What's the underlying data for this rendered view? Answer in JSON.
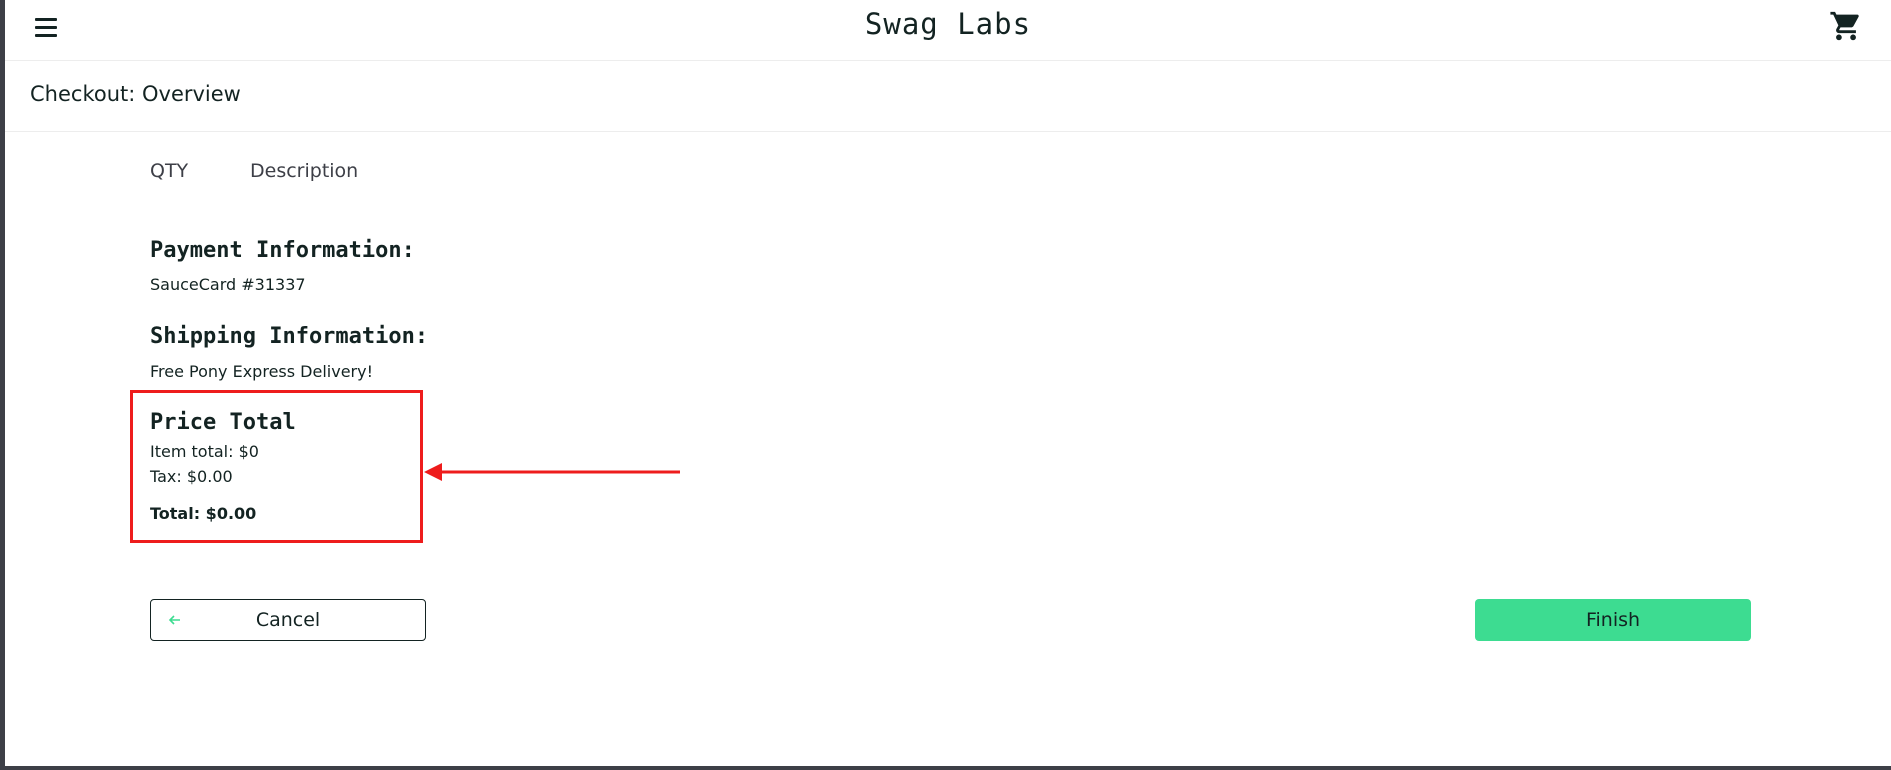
{
  "header": {
    "app_title": "Swag Labs",
    "menu_icon": "hamburger-menu-icon",
    "cart_icon": "shopping-cart-icon"
  },
  "page": {
    "title": "Checkout: Overview"
  },
  "columns": {
    "qty": "QTY",
    "description": "Description"
  },
  "payment": {
    "label": "Payment Information:",
    "value": "SauceCard #31337"
  },
  "shipping": {
    "label": "Shipping Information:",
    "value": "Free Pony Express Delivery!"
  },
  "price": {
    "label": "Price Total",
    "item_total": "Item total: $0",
    "tax": "Tax: $0.00",
    "total": "Total: $0.00"
  },
  "actions": {
    "cancel_label": "Cancel",
    "finish_label": "Finish"
  },
  "colors": {
    "accent": "#3ddc91",
    "annotation": "#ee1c1c",
    "text": "#132322"
  }
}
